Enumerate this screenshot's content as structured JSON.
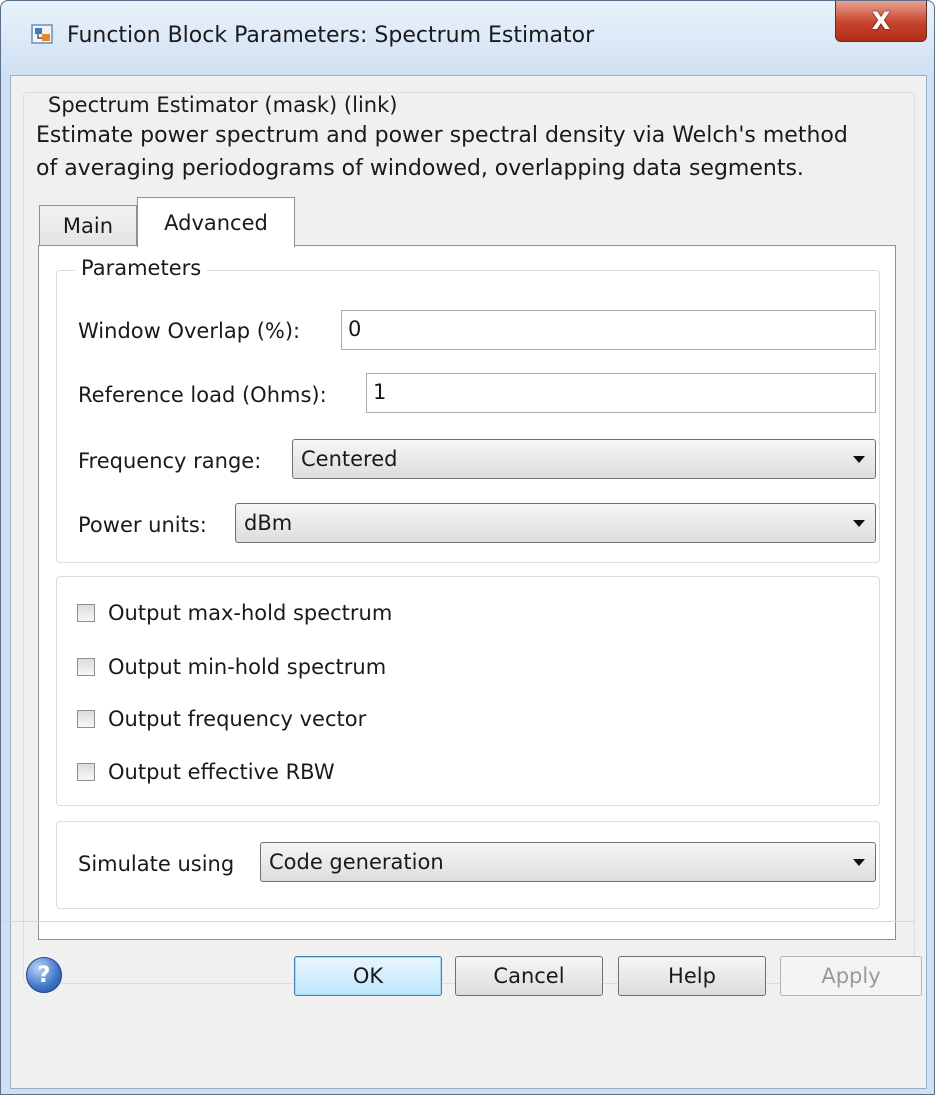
{
  "window": {
    "title": "Function Block Parameters: Spectrum Estimator",
    "close_glyph": "X"
  },
  "mask": {
    "legend": "Spectrum Estimator (mask) (link)",
    "description_line1": "Estimate power spectrum and power spectral density via Welch's method",
    "description_line2": "of averaging periodograms of windowed, overlapping data segments."
  },
  "tabs": [
    {
      "label": "Main",
      "selected": false
    },
    {
      "label": "Advanced",
      "selected": true
    }
  ],
  "parameters": {
    "legend": "Parameters",
    "window_overlap": {
      "label": "Window Overlap (%):",
      "value": "0"
    },
    "reference_load": {
      "label": "Reference load (Ohms):",
      "value": "1"
    },
    "frequency_range": {
      "label": "Frequency range:",
      "value": "Centered"
    },
    "power_units": {
      "label": "Power units:",
      "value": "dBm"
    }
  },
  "checkboxes": [
    {
      "label": "Output max-hold spectrum",
      "checked": false
    },
    {
      "label": "Output min-hold spectrum",
      "checked": false
    },
    {
      "label": "Output frequency vector",
      "checked": false
    },
    {
      "label": "Output effective RBW",
      "checked": false
    }
  ],
  "simulate": {
    "label": "Simulate using",
    "value": "Code generation"
  },
  "buttons": {
    "ok": "OK",
    "cancel": "Cancel",
    "help": "Help",
    "apply": "Apply",
    "apply_enabled": false
  },
  "icons": {
    "app": "simulink-block-icon",
    "help": "question-mark-icon",
    "dropdown": "chevron-down-icon"
  },
  "colors": {
    "window_frame": "#cfe0f2",
    "close_button": "#c7432b",
    "ok_button": "#bee6fd"
  }
}
